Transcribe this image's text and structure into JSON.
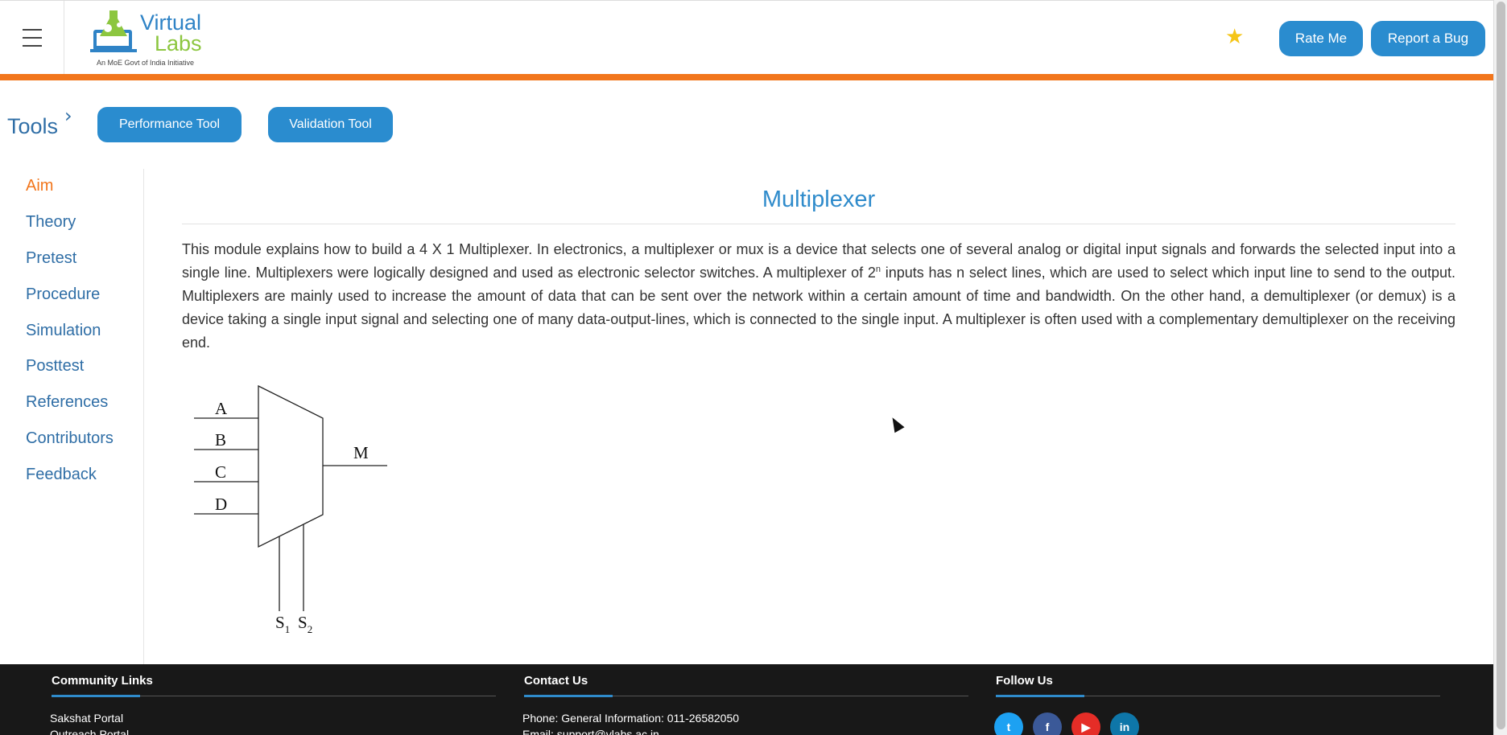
{
  "header": {
    "logo_word1": "Virtual",
    "logo_word2": "Labs",
    "logo_tagline": "An MoE Govt of India Initiative",
    "rate_label": "Rate Me",
    "bug_label": "Report a Bug",
    "star_icon": "star-icon",
    "menu_icon": "hamburger-icon"
  },
  "tools": {
    "label": "Tools",
    "performance_label": "Performance Tool",
    "validation_label": "Validation Tool"
  },
  "sidebar": {
    "items": [
      {
        "label": "Aim",
        "active": true
      },
      {
        "label": "Theory"
      },
      {
        "label": "Pretest"
      },
      {
        "label": "Procedure"
      },
      {
        "label": "Simulation"
      },
      {
        "label": "Posttest"
      },
      {
        "label": "References"
      },
      {
        "label": "Contributors"
      },
      {
        "label": "Feedback"
      }
    ]
  },
  "content": {
    "title": "Multiplexer",
    "para_part1": "This module explains how to build a 4 X 1 Multiplexer. In electronics, a multiplexer or mux is a device that selects one of several analog or digital input signals and forwards the selected input into a single line. Multiplexers were logically designed and used as electronic selector switches. A multiplexer of 2",
    "para_sup": "n",
    "para_part2": " inputs has n select lines, which are used to select which input line to send to the output. Multiplexers are mainly used to increase the amount of data that can be sent over the network within a certain amount of time and bandwidth. On the other hand, a demultiplexer (or demux) is a device taking a single input signal and selecting one of many data-output-lines, which is connected to the single input. A multiplexer is often used with a complementary demultiplexer on the receiving end.",
    "diagram": {
      "inputs": [
        "A",
        "B",
        "C",
        "D"
      ],
      "output": "M",
      "selects": [
        {
          "base": "S",
          "sub": "1"
        },
        {
          "base": "S",
          "sub": "2"
        }
      ]
    }
  },
  "footer": {
    "community_head": "Community Links",
    "community_links": [
      "Sakshat Portal",
      "Outreach Portal"
    ],
    "contact_head": "Contact Us",
    "contact_lines": [
      "Phone: General Information: 011-26582050",
      "Email: support@vlabs.ac.in"
    ],
    "follow_head": "Follow Us",
    "social": [
      {
        "icon": "twitter-icon",
        "glyph": "t",
        "color": "#1da1f2"
      },
      {
        "icon": "facebook-icon",
        "glyph": "f",
        "color": "#3b5998"
      },
      {
        "icon": "youtube-icon",
        "glyph": "▶",
        "color": "#e52d27"
      },
      {
        "icon": "linkedin-icon",
        "glyph": "in",
        "color": "#0e76a8"
      }
    ]
  },
  "colors": {
    "accent_blue": "#2a8ccf",
    "accent_orange": "#f2761c",
    "footer_bg": "#181818"
  }
}
